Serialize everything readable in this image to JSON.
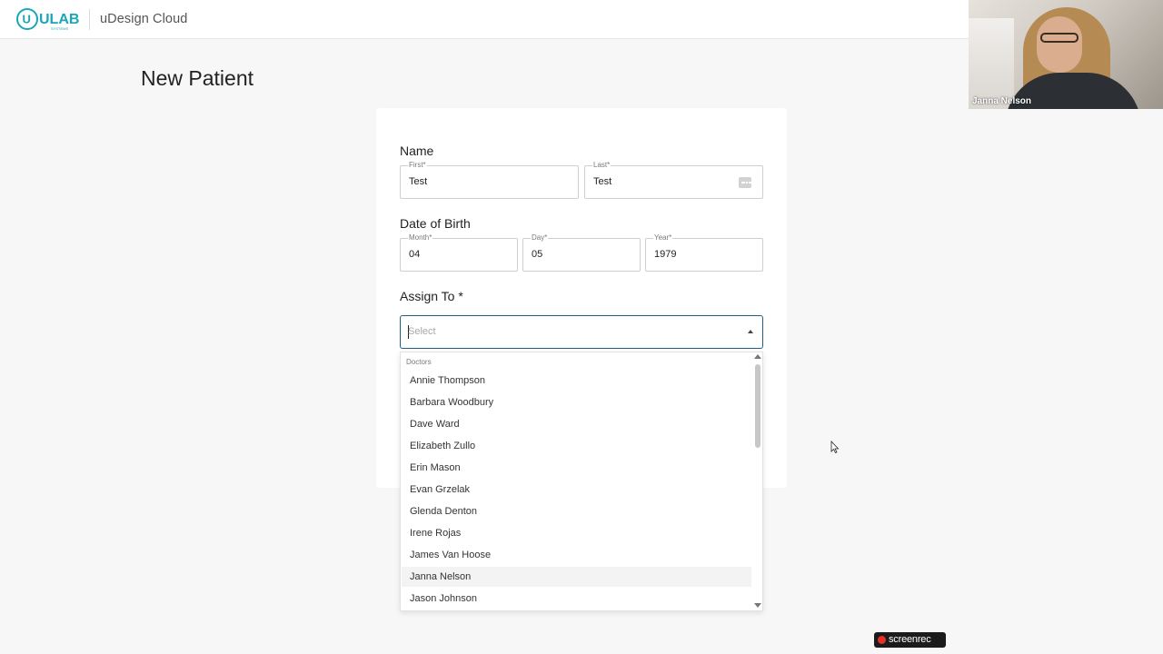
{
  "header": {
    "logo_text": "ULAB",
    "logo_subtext": "SYSTEMS",
    "app_title": "uDesign Cloud"
  },
  "page": {
    "title": "New Patient"
  },
  "form": {
    "name_section": "Name",
    "first_label": "First*",
    "first_value": "Test",
    "last_label": "Last*",
    "last_value": "Test",
    "dob_section": "Date of Birth",
    "month_label": "Month*",
    "month_value": "04",
    "day_label": "Day*",
    "day_value": "05",
    "year_label": "Year*",
    "year_value": "1979",
    "assign_section": "Assign To *",
    "assign_placeholder": "Select"
  },
  "dropdown": {
    "group_label": "Doctors",
    "options": [
      "Annie Thompson",
      "Barbara Woodbury",
      "Dave Ward",
      "Elizabeth Zullo",
      "Erin Mason",
      "Evan Grzelak",
      "Glenda Denton",
      "Irene Rojas",
      "James Van Hoose",
      "Janna Nelson",
      "Jason Johnson"
    ],
    "hovered_option": "Janna Nelson"
  },
  "webcam": {
    "participant_name": "Janna Nelson"
  },
  "recorder": {
    "label": "screenrec"
  },
  "colors": {
    "accent": "#1f5e86",
    "logo": "#1aa6b7",
    "background": "#f7f7f7"
  }
}
